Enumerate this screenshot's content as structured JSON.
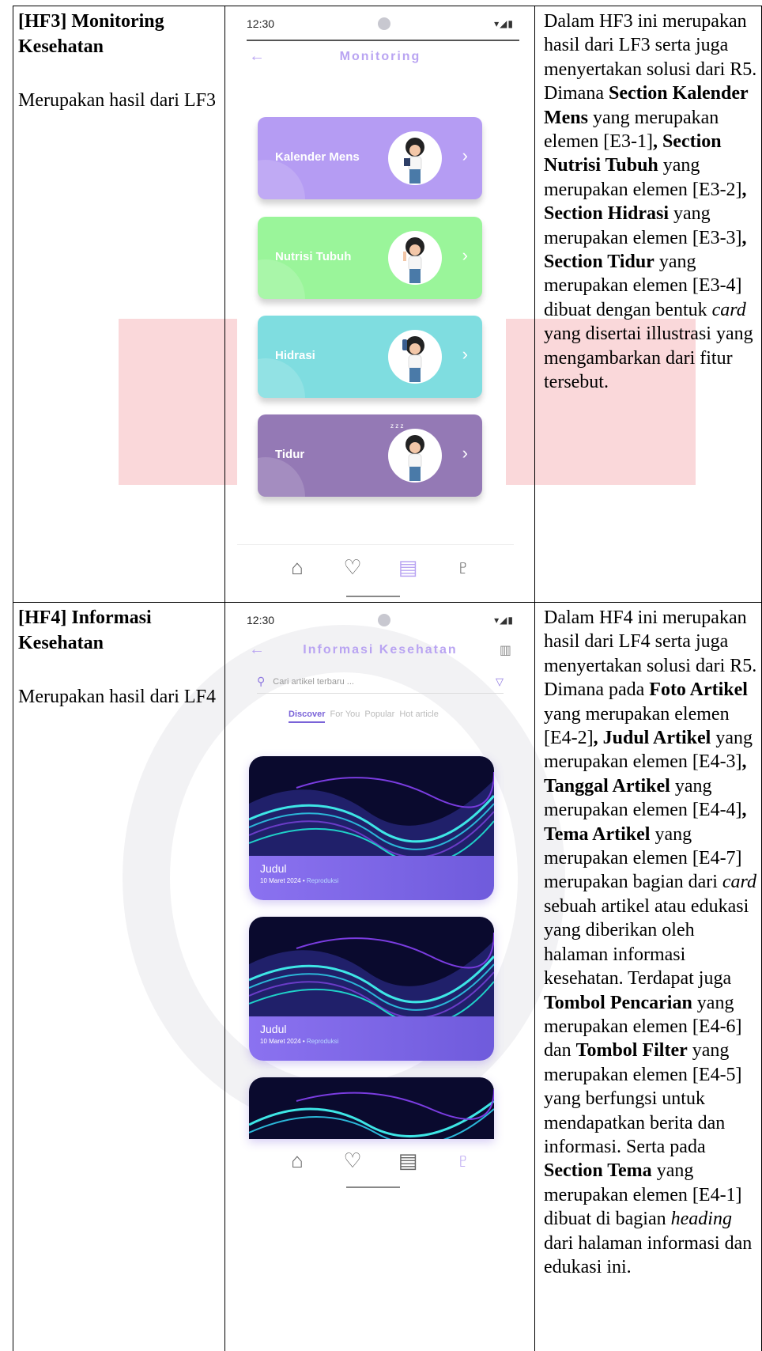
{
  "rows": [
    {
      "title": "[HF3] Monitoring Kesehatan",
      "subtitle": "Merupakan hasil dari LF3",
      "desc": [
        {
          "t": "Dalam HF3 ini merupakan hasil dari LF3 serta juga menyertakan solusi dari R5. Dimana "
        },
        {
          "t": "Section Kalender Mens",
          "b": true
        },
        {
          "t": " yang merupakan elemen [E3-1]"
        },
        {
          "t": ", Section Nutrisi Tubuh",
          "b": true
        },
        {
          "t": " yang merupakan elemen [E3-2]"
        },
        {
          "t": ", Section Hidrasi",
          "b": true
        },
        {
          "t": " yang merupakan elemen [E3-3]"
        },
        {
          "t": ", Section Tidur",
          "b": true
        },
        {
          "t": " yang merupakan elemen [E3-4] dibuat dengan bentuk "
        },
        {
          "t": "card",
          "i": true
        },
        {
          "t": " yang disertai illustrasi yang mengambarkan dari fitur tersebut."
        }
      ]
    },
    {
      "title": "[HF4] Informasi Kesehatan",
      "subtitle": "Merupakan hasil dari LF4",
      "desc": [
        {
          "t": "Dalam HF4 ini merupakan hasil dari LF4 serta juga menyertakan solusi dari R5. Dimana pada "
        },
        {
          "t": "Foto Artikel",
          "b": true
        },
        {
          "t": " yang merupakan elemen [E4-2]"
        },
        {
          "t": ", Judul Artikel",
          "b": true
        },
        {
          "t": " yang merupakan elemen [E4-3]"
        },
        {
          "t": ", Tanggal Artikel",
          "b": true
        },
        {
          "t": " yang merupakan elemen [E4-4]"
        },
        {
          "t": ", Tema Artikel",
          "b": true
        },
        {
          "t": " yang merupakan elemen [E4-7] merupakan bagian dari "
        },
        {
          "t": "card",
          "i": true
        },
        {
          "t": " sebuah artikel atau edukasi yang diberikan oleh halaman informasi kesehatan. Terdapat juga "
        },
        {
          "t": "Tombol Pencarian",
          "b": true
        },
        {
          "t": " yang merupakan elemen [E4-6] dan "
        },
        {
          "t": "Tombol Filter",
          "b": true
        },
        {
          "t": " yang merupakan elemen [E4-5] yang berfungsi untuk mendapatkan berita dan informasi. Serta pada "
        },
        {
          "t": "Section Tema",
          "b": true
        },
        {
          "t": " yang merupakan elemen [E4-1] dibuat di bagian "
        },
        {
          "t": "heading",
          "i": true
        },
        {
          "t": " dari halaman informasi dan edukasi ini."
        }
      ]
    }
  ],
  "phone1": {
    "time": "12:30",
    "signal": "▾◢▮",
    "header_title": "Monitoring",
    "cards": [
      {
        "label": "Kalender Mens",
        "color": "#b59cf3"
      },
      {
        "label": "Nutrisi Tubuh",
        "color": "#9af59a"
      },
      {
        "label": "Hidrasi",
        "color": "#7fdde0"
      },
      {
        "label": "Tidur",
        "color": "#9479b5",
        "zz": "z z z"
      }
    ],
    "nav_icons": [
      "home-icon",
      "heart-monitor-icon",
      "clipboard-icon",
      "stethoscope-icon"
    ]
  },
  "phone2": {
    "time": "12:30",
    "signal": "▾◢▮",
    "header_title": "Informasi Kesehatan",
    "search_placeholder": "Cari artikel terbaru ...",
    "tabs": [
      "Discover",
      "For You",
      "Popular",
      "Hot article"
    ],
    "articles": [
      {
        "title": "Judul",
        "date": "10 Maret 2024",
        "tag": "Reproduksi"
      },
      {
        "title": "Judul",
        "date": "10 Maret 2024",
        "tag": "Reproduksi"
      }
    ],
    "nav_icons": [
      "home-icon",
      "heart-monitor-icon",
      "clipboard-icon",
      "stethoscope-icon"
    ]
  }
}
